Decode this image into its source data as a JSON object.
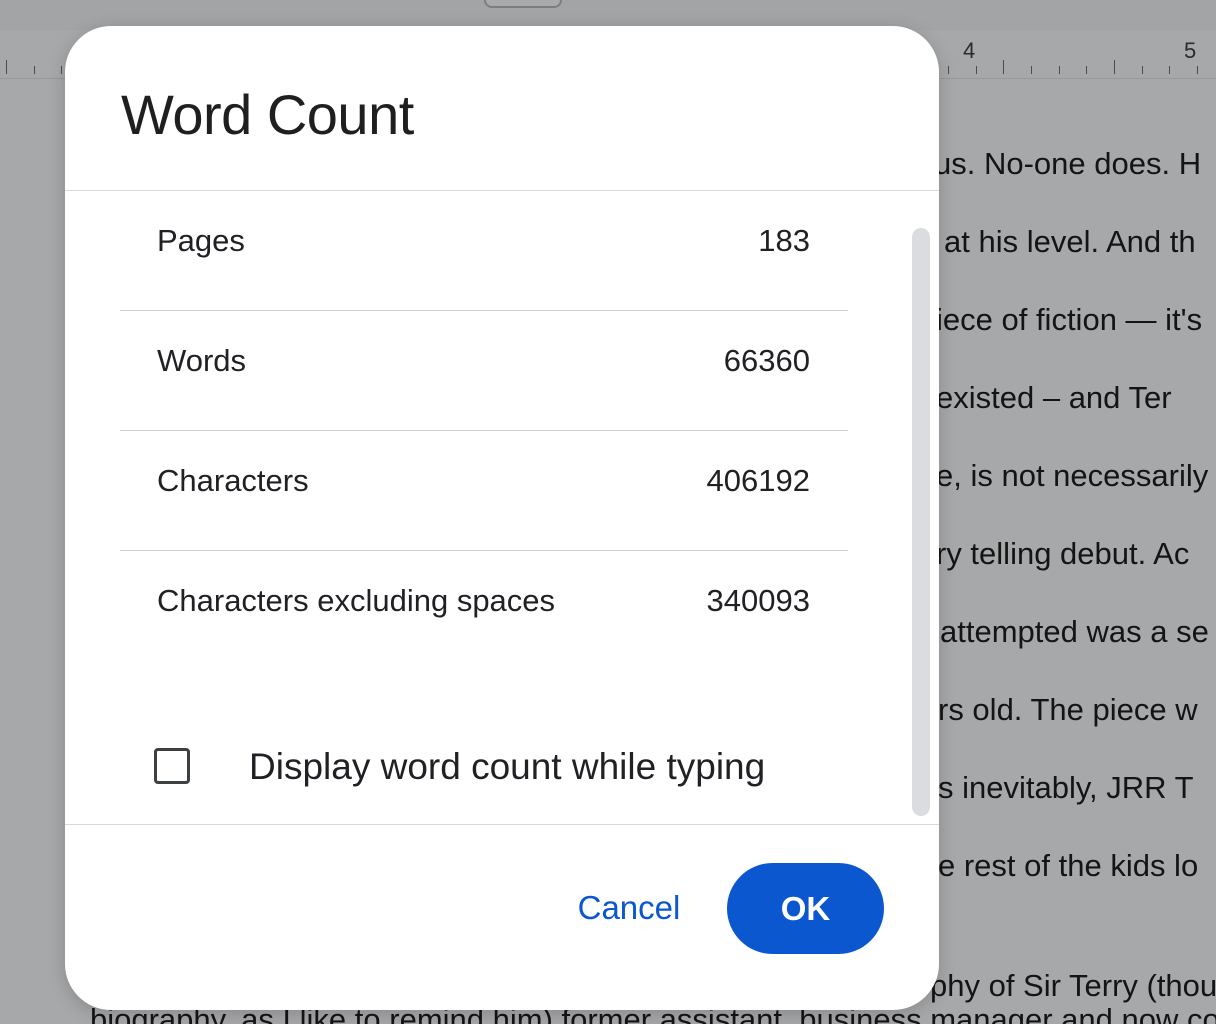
{
  "ruler": {
    "numbers": [
      "4",
      "5"
    ]
  },
  "document": {
    "lines": [
      "us. No-one does. H",
      "at his level. And th",
      "iece of fiction — it's",
      "existed  – and Ter",
      "e, is not necessarily",
      "ry telling debut. Ac",
      "attempted was a se",
      "rs old. The piece w",
      "s inevitably, JRR T",
      "e rest of the kids lo",
      "phy of Sir Terry (thou",
      "biography, as I like to remind him) former assistant, business manager and now co-"
    ]
  },
  "dialog": {
    "title": "Word Count",
    "stats": [
      {
        "label": "Pages",
        "value": "183"
      },
      {
        "label": "Words",
        "value": "66360"
      },
      {
        "label": "Characters",
        "value": "406192"
      },
      {
        "label": "Characters excluding spaces",
        "value": "340093"
      }
    ],
    "checkbox": {
      "label": "Display word count while typing",
      "checked": false
    },
    "buttons": {
      "cancel": "Cancel",
      "ok": "OK"
    }
  },
  "colors": {
    "accent": "#0b57d0",
    "text": "#202124",
    "overlay_bg": "#a7a8aa"
  }
}
